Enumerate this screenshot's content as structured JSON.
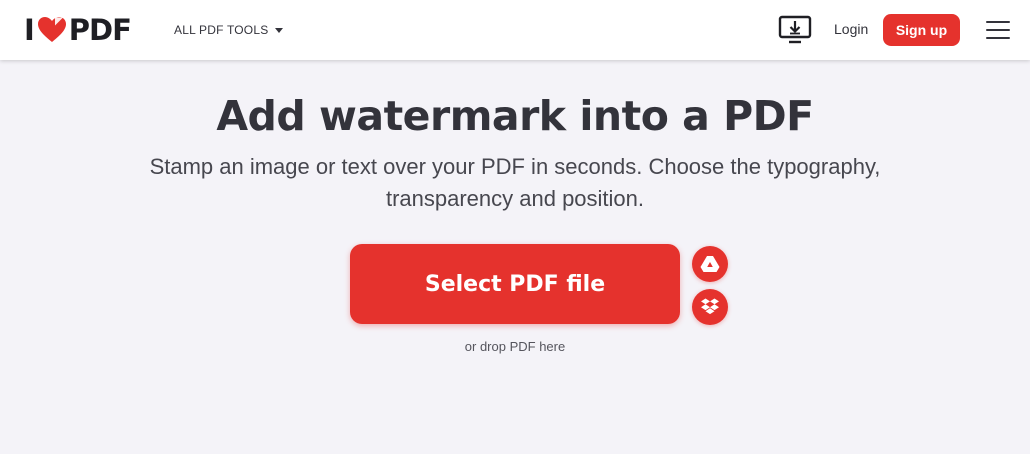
{
  "header": {
    "logo": {
      "prefix": "I",
      "suffix": "PDF",
      "brand_color": "#e5322d"
    },
    "tools_menu_label": "ALL PDF TOOLS",
    "desktop_icon": "desktop-download-icon",
    "login_label": "Login",
    "signup_label": "Sign up",
    "menu_icon": "hamburger-menu-icon"
  },
  "main": {
    "title": "Add watermark into a PDF",
    "subtitle_line1": "Stamp an image or text over your PDF in seconds. Choose the typography,",
    "subtitle_line2": "transparency and position.",
    "select_button_label": "Select PDF file",
    "cloud_buttons": [
      "google-drive-icon",
      "dropbox-icon"
    ],
    "drop_hint": "or drop PDF here"
  },
  "colors": {
    "accent": "#e5322d",
    "background": "#f4f3f8",
    "text": "#33333b"
  }
}
